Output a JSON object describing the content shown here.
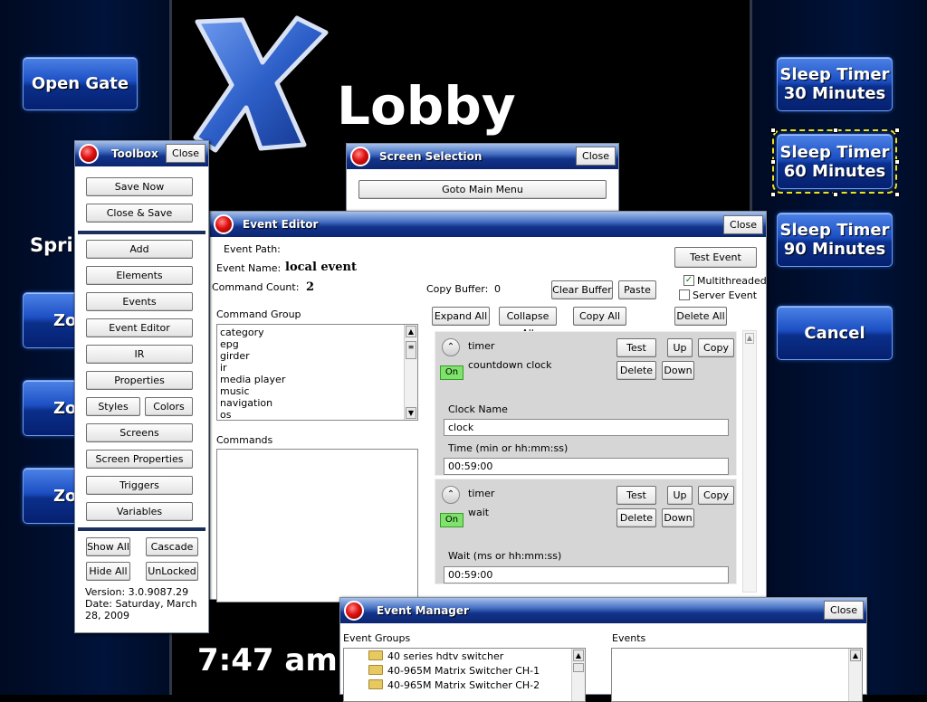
{
  "screen": {
    "logo_title": "Lobby",
    "partial_label": "Sprin",
    "clock": "7:47 am",
    "left_buttons": [
      "Open Gate",
      "Zo",
      "Zo",
      "Zo"
    ],
    "right_buttons": [
      {
        "line1": "Sleep Timer",
        "line2": "30 Minutes"
      },
      {
        "line1": "Sleep Timer",
        "line2": "60 Minutes"
      },
      {
        "line1": "Sleep Timer",
        "line2": "90 Minutes"
      },
      {
        "line1": "Cancel",
        "line2": ""
      }
    ],
    "colors": {
      "accent": "#1c4fc4",
      "selection": "#f0e020"
    }
  },
  "toolbox": {
    "title": "Toolbox",
    "close": "Close",
    "save_now": "Save Now",
    "close_save": "Close & Save",
    "items": [
      "Add",
      "Elements",
      "Events",
      "Event Editor",
      "IR",
      "Properties"
    ],
    "styles": "Styles",
    "colors": "Colors",
    "items2": [
      "Screens",
      "Screen Properties",
      "Triggers",
      "Variables"
    ],
    "show_all": "Show All",
    "cascade": "Cascade",
    "hide_all": "Hide All",
    "unlocked": "UnLocked",
    "version": "Version: 3.0.9087.29",
    "date": "Date: Saturday, March 28, 2009"
  },
  "screen_selection": {
    "title": "Screen Selection",
    "close": "Close",
    "goto_main": "Goto Main Menu"
  },
  "event_editor": {
    "title": "Event Editor",
    "close": "Close",
    "event_path_label": "Event Path:",
    "event_name_label": "Event Name:",
    "event_name_value": "local event",
    "command_count_label": "Command Count:",
    "command_count_value": "2",
    "copy_buffer_label": "Copy Buffer:",
    "copy_buffer_value": "0",
    "clear_buffer": "Clear Buffer",
    "paste": "Paste",
    "test_event": "Test Event",
    "multithreaded": "Multithreaded",
    "multithreaded_checked": true,
    "server_event": "Server Event",
    "server_event_checked": false,
    "expand_all": "Expand All",
    "collapse_all": "Collapse All",
    "copy_all": "Copy All",
    "delete_all": "Delete All",
    "command_group_label": "Command Group",
    "command_groups": [
      "category",
      "epg",
      "girder",
      "ir",
      "media player",
      "music",
      "navigation",
      "os"
    ],
    "commands_label": "Commands",
    "cmd_buttons": {
      "test": "Test",
      "up": "Up",
      "copy": "Copy",
      "delete": "Delete",
      "down": "Down",
      "on": "On"
    },
    "commands": [
      {
        "type": "timer",
        "name": "countdown clock",
        "field1_label": "Clock Name",
        "field1_value": "clock",
        "field2_label": "Time (min or hh:mm:ss)",
        "field2_value": "00:59:00"
      },
      {
        "type": "timer",
        "name": "wait",
        "field1_label": "Wait (ms or hh:mm:ss)",
        "field1_value": "00:59:00"
      }
    ]
  },
  "event_manager": {
    "title": "Event Manager",
    "close": "Close",
    "groups_label": "Event Groups",
    "events_label": "Events",
    "groups": [
      "40 series hdtv switcher",
      "40-965M Matrix Switcher CH-1",
      "40-965M Matrix Switcher CH-2"
    ]
  }
}
